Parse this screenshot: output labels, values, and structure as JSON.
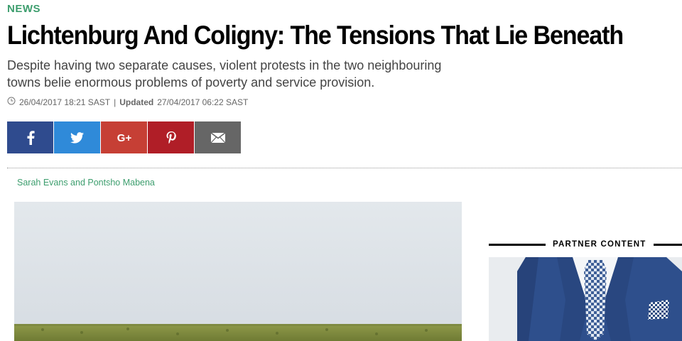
{
  "article": {
    "section": "NEWS",
    "title": "Lichtenburg And Coligny: The Tensions That Lie Beneath",
    "subtitle": "Despite having two separate causes, violent protests in the two neighbouring towns belie enormous problems of poverty and service provision.",
    "published": "26/04/2017 18:21 SAST",
    "separator": "|",
    "updated_label": "Updated",
    "updated": "27/04/2017 06:22 SAST",
    "byline": "Sarah Evans and Pontsho Mabena"
  },
  "share": {
    "buttons": [
      {
        "name": "facebook",
        "icon": "facebook-icon",
        "color": "#2f4b8e"
      },
      {
        "name": "twitter",
        "icon": "twitter-icon",
        "color": "#2f8ad9"
      },
      {
        "name": "google-plus",
        "icon": "google-plus-icon",
        "label": "G+",
        "color": "#c63f35"
      },
      {
        "name": "pinterest",
        "icon": "pinterest-icon",
        "color": "#b01e27"
      },
      {
        "name": "email",
        "icon": "email-icon",
        "color": "#666666"
      }
    ]
  },
  "sidebar": {
    "partner_label": "PARTNER CONTENT"
  },
  "colors": {
    "accent": "#3d9e6e",
    "headline": "#000000",
    "subtitle": "#444444"
  }
}
